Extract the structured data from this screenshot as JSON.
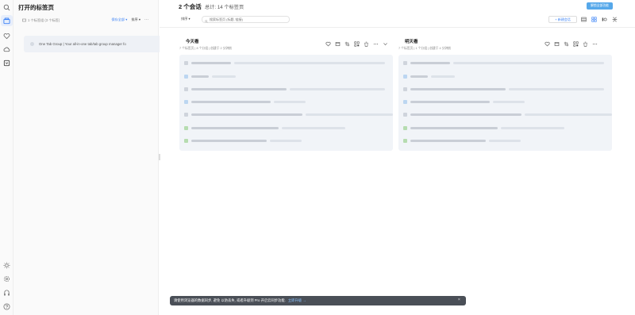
{
  "sidebar": {
    "icons": [
      "search-icon",
      "tabs-icon",
      "heart-icon",
      "cloud-icon",
      "import-icon",
      "theme-icon",
      "settings-icon",
      "feedback-icon",
      "help-icon"
    ]
  },
  "panel": {
    "title": "打开的标签页",
    "meta": "1 个标签组 (3 个标签)",
    "save_label": "保存全部",
    "sort_label": "排序",
    "more_label": "···",
    "tab_item": "One Tab Group | Your all-in-one tab/tab group manager fo"
  },
  "main": {
    "title": "2 个会话",
    "total": "总计: 14 个标签页",
    "top_button": "解锁全部功能",
    "sort_label": "排序",
    "search_placeholder": "搜索标签页 (标题, 链接)",
    "new_session": "+ 新建会话"
  },
  "sessions": [
    {
      "name": "今天看",
      "meta": "7 个标签页 | 8 个分组 | 创建于 2 分钟前"
    },
    {
      "name": "明天看",
      "meta": "7 个标签页 | 1 个分组 | 创建于 4 分钟前"
    }
  ],
  "toast": {
    "text": "请使用浏览器的数据同步, 避免 以防丢失, 或者升级到 Pro 开启云同步功能.",
    "link": "立即升级 →",
    "close": "×"
  },
  "colors": {
    "accent": "#56a8ea",
    "link": "#3b82f6",
    "toast_bg": "#4a4f57"
  }
}
